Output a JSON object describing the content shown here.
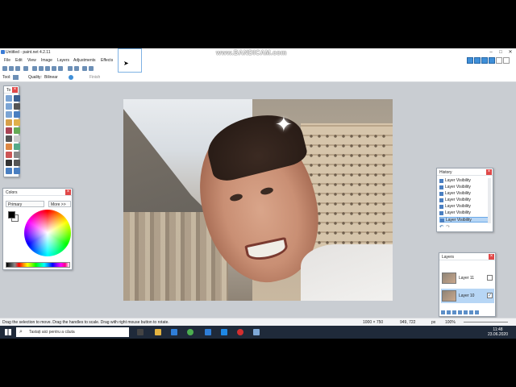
{
  "window": {
    "title": "Untitled - paint.net 4.2.11"
  },
  "watermark": "www.BANDICAM.com",
  "menu": [
    "File",
    "Edit",
    "View",
    "Image",
    "Layers",
    "Adjustments",
    "Effects"
  ],
  "toolbar": {
    "tool_label": "Tool:",
    "quality_label": "Quality:",
    "quality_value": "Bilinear",
    "finish_label": "Finish"
  },
  "colors_panel": {
    "title": "Colors",
    "mode": "Primary",
    "more": "More >>",
    "accent": "#3f8fd8"
  },
  "history_panel": {
    "title": "History",
    "items": [
      "Layer Visibility",
      "Layer Visibility",
      "Layer Visibility",
      "Layer Visibility",
      "Layer Visibility",
      "Layer Visibility",
      "Layer Visibility"
    ]
  },
  "layers_panel": {
    "title": "Layers",
    "layers": [
      {
        "name": "Layer 11",
        "visible": ""
      },
      {
        "name": "Layer 10",
        "visible": "✓"
      }
    ]
  },
  "statusbar": {
    "hint": "Drag the selection to move. Drag the handles to scale. Drag with right mouse button to rotate.",
    "size": "1000 × 750",
    "pos": "949, 722",
    "unit": "px",
    "zoom": "100%"
  },
  "taskbar": {
    "search_placeholder": "Tastați aici pentru a căuta",
    "time": "11:48",
    "date": "23.06.2020"
  }
}
